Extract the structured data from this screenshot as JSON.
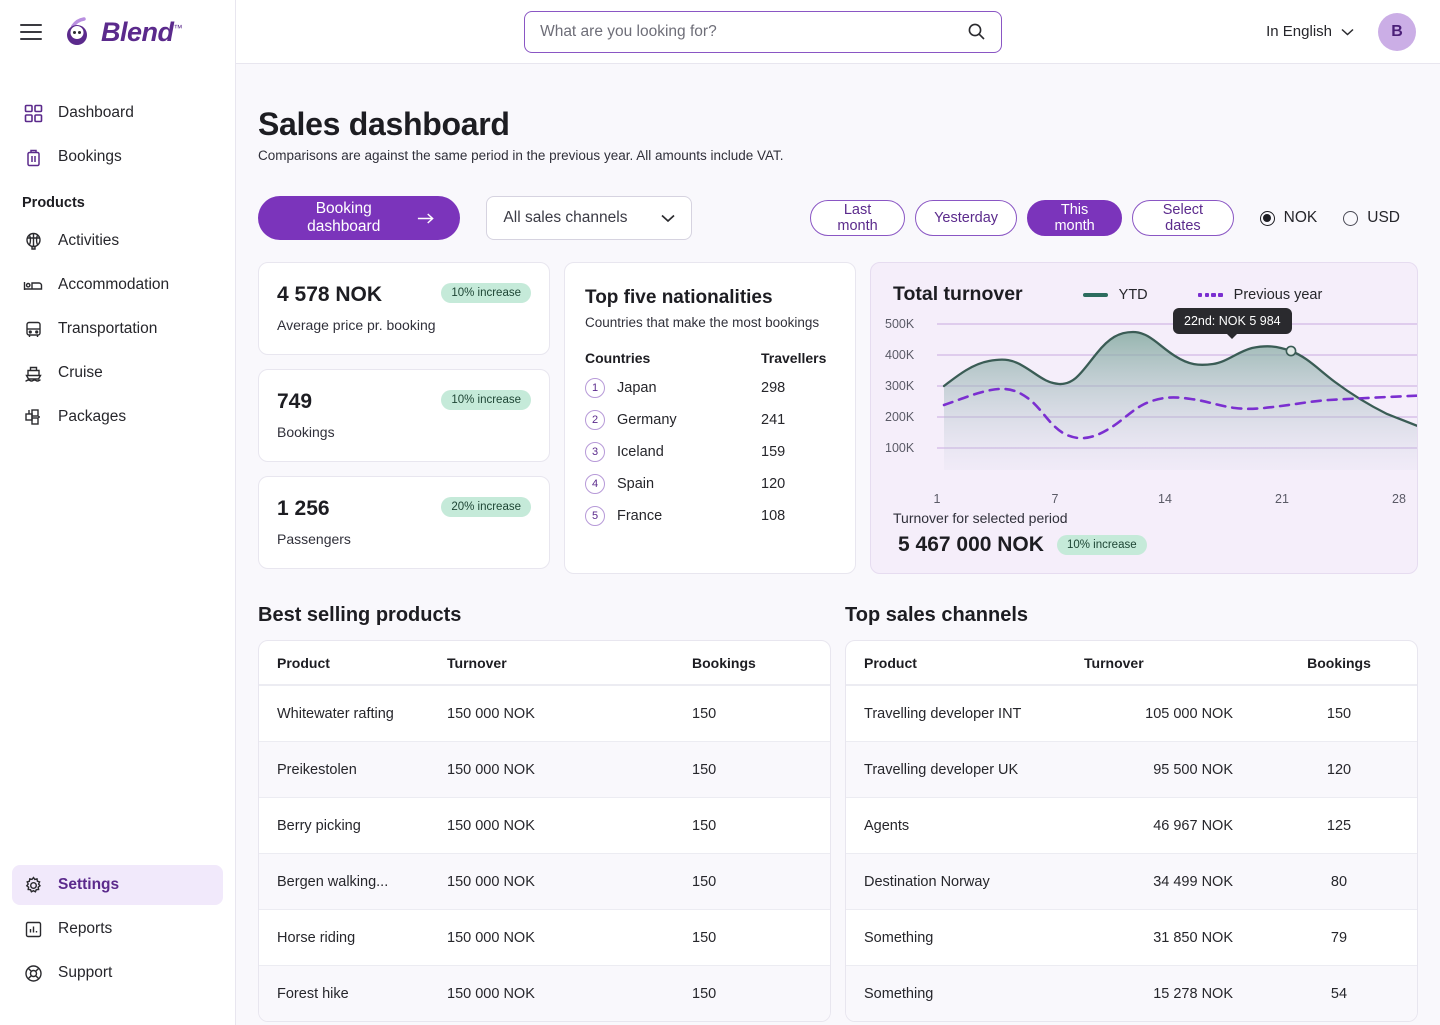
{
  "brand": {
    "name": "Blend",
    "tm": "™"
  },
  "sidebar": {
    "nav_top": [
      {
        "label": "Dashboard",
        "icon": "dashboard-icon"
      },
      {
        "label": "Bookings",
        "icon": "suitcase-icon"
      }
    ],
    "section_label": "Products",
    "products": [
      {
        "label": "Activities",
        "icon": "balloon-icon"
      },
      {
        "label": "Accommodation",
        "icon": "bed-icon"
      },
      {
        "label": "Transportation",
        "icon": "bus-icon"
      },
      {
        "label": "Cruise",
        "icon": "ship-icon"
      },
      {
        "label": "Packages",
        "icon": "packages-icon"
      }
    ],
    "bottom": [
      {
        "label": "Settings",
        "icon": "gear-icon",
        "active": true
      },
      {
        "label": "Reports",
        "icon": "bar-chart-icon",
        "active": false
      },
      {
        "label": "Support",
        "icon": "lifebuoy-icon",
        "active": false
      }
    ]
  },
  "topbar": {
    "search_placeholder": "What are you looking for?",
    "search_value": "",
    "language": "In English",
    "avatar_initial": "B"
  },
  "page": {
    "title": "Sales dashboard",
    "subtitle": "Comparisons are against the same period in the previous year. All amounts include VAT."
  },
  "controls": {
    "primary_button": "Booking dashboard",
    "channel_select": "All sales channels",
    "date_chips": [
      {
        "label": "Last month",
        "active": false
      },
      {
        "label": "Yesterday",
        "active": false
      },
      {
        "label": "This month",
        "active": true
      },
      {
        "label": "Select dates",
        "active": false
      }
    ],
    "currencies": [
      {
        "label": "NOK",
        "selected": true
      },
      {
        "label": "USD",
        "selected": false
      }
    ]
  },
  "kpis": [
    {
      "value": "4 578 NOK",
      "badge": "10% increase",
      "label": "Average price pr. booking"
    },
    {
      "value": "749",
      "badge": "10% increase",
      "label": "Bookings"
    },
    {
      "value": "1 256",
      "badge": "20% increase",
      "label": "Passengers"
    }
  ],
  "nationalities": {
    "title": "Top five nationalities",
    "subtitle": "Countries that make the most bookings",
    "col_country": "Countries",
    "col_travellers": "Travellers",
    "rows": [
      {
        "rank": "1",
        "country": "Japan",
        "travellers": "298"
      },
      {
        "rank": "2",
        "country": "Germany",
        "travellers": "241"
      },
      {
        "rank": "3",
        "country": "Iceland",
        "travellers": "159"
      },
      {
        "rank": "4",
        "country": "Spain",
        "travellers": "120"
      },
      {
        "rank": "5",
        "country": "France",
        "travellers": "108"
      }
    ]
  },
  "turnover": {
    "title": "Total turnover",
    "legend": [
      {
        "label": "YTD",
        "style": "solid",
        "color": "#2c6c5e"
      },
      {
        "label": "Previous year",
        "style": "dotted",
        "color": "#7b2fd0"
      }
    ],
    "tooltip": "22nd: NOK 5 984",
    "footer_label": "Turnover for selected period",
    "footer_value": "5 467 000 NOK",
    "footer_badge": "10% increase"
  },
  "chart_data": {
    "type": "area",
    "title": "Total turnover",
    "xlabel": "",
    "ylabel": "",
    "ylim": [
      100000,
      500000
    ],
    "yticks": [
      "100K",
      "200K",
      "300K",
      "400K",
      "500K"
    ],
    "ytick_values": [
      100000,
      200000,
      300000,
      400000,
      500000
    ],
    "xticks": [
      "1",
      "7",
      "14",
      "21",
      "28"
    ],
    "xtick_values": [
      1,
      7,
      14,
      21,
      28
    ],
    "grid": true,
    "legend_position": "top-right",
    "annotation": {
      "label": "22nd: NOK 5 984",
      "x": 22,
      "y": 440000
    },
    "series": [
      {
        "name": "YTD",
        "style": "solid",
        "color": "#2c6c5e",
        "x": [
          1,
          2,
          3,
          4,
          5,
          6,
          7,
          8,
          9,
          10,
          11,
          12,
          13,
          14,
          15,
          16,
          17,
          18,
          19,
          20,
          21,
          22,
          23,
          24,
          25,
          26,
          27,
          28,
          29,
          30,
          31
        ],
        "values": [
          300000,
          330000,
          355000,
          370000,
          375000,
          370000,
          358000,
          345000,
          335000,
          332000,
          345000,
          385000,
          430000,
          462000,
          470000,
          462000,
          440000,
          418000,
          405000,
          402000,
          412000,
          438000,
          444000,
          444000,
          438000,
          425000,
          408000,
          388000,
          365000,
          345000,
          325000
        ]
      },
      {
        "name": "Previous year",
        "style": "dotted",
        "color": "#7b2fd0",
        "x": [
          1,
          2,
          3,
          4,
          5,
          6,
          7,
          8,
          9,
          10,
          11,
          12,
          13,
          14,
          15,
          16,
          17,
          18,
          19,
          20,
          21,
          22,
          23,
          24,
          25,
          26,
          27,
          28,
          29,
          30,
          31
        ],
        "values": [
          238000,
          255000,
          272000,
          282000,
          285000,
          282000,
          272000,
          252000,
          222000,
          192000,
          172000,
          163000,
          162000,
          170000,
          188000,
          210000,
          232000,
          248000,
          256000,
          258000,
          256000,
          248000,
          238000,
          228000,
          224000,
          224000,
          228000,
          234000,
          242000,
          250000,
          256000
        ]
      }
    ]
  },
  "best_selling": {
    "title": "Best selling products",
    "columns": [
      "Product",
      "Turnover",
      "Bookings"
    ],
    "rows": [
      {
        "product": "Whitewater rafting",
        "turnover": "150 000 NOK",
        "bookings": "150"
      },
      {
        "product": "Preikestolen",
        "turnover": "150 000 NOK",
        "bookings": "150"
      },
      {
        "product": "Berry picking",
        "turnover": "150 000 NOK",
        "bookings": "150"
      },
      {
        "product": "Bergen walking...",
        "turnover": "150 000 NOK",
        "bookings": "150"
      },
      {
        "product": "Horse riding",
        "turnover": "150 000 NOK",
        "bookings": "150"
      },
      {
        "product": "Forest hike",
        "turnover": "150 000 NOK",
        "bookings": "150"
      }
    ]
  },
  "top_channels": {
    "title": "Top sales channels",
    "columns": [
      "Product",
      "Turnover",
      "Bookings"
    ],
    "rows": [
      {
        "product": "Travelling developer INT",
        "turnover": "105 000 NOK",
        "bookings": "150"
      },
      {
        "product": "Travelling developer UK",
        "turnover": "95 500 NOK",
        "bookings": "120"
      },
      {
        "product": "Agents",
        "turnover": "46 967 NOK",
        "bookings": "125"
      },
      {
        "product": "Destination Norway",
        "turnover": "34 499 NOK",
        "bookings": "80"
      },
      {
        "product": "Something",
        "turnover": "31 850 NOK",
        "bookings": "79"
      },
      {
        "product": "Something",
        "turnover": "15 278 NOK",
        "bookings": "54"
      }
    ]
  },
  "colors": {
    "brand_purple": "#5b2a8c",
    "accent_purple": "#7b34bb",
    "badge_green_bg": "#c5ead9",
    "chart_ytd": "#2c6c5e",
    "chart_prev": "#7b2fd0",
    "chart_bg": "#f5eefa"
  }
}
